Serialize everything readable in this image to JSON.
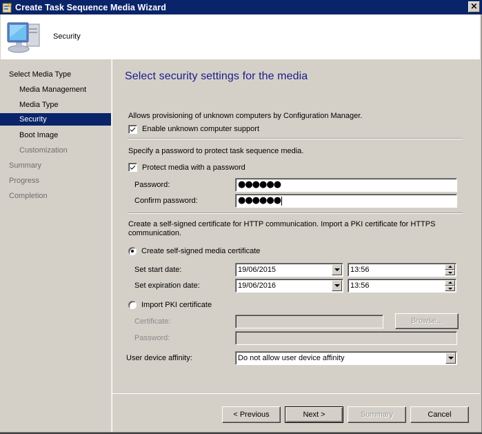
{
  "window": {
    "title": "Create Task Sequence Media Wizard",
    "close_label": "×",
    "app_icon": "wizard-icon"
  },
  "header": {
    "title": "Security",
    "icon": "computer-icon"
  },
  "nav": {
    "items": [
      {
        "label": "Select Media Type",
        "level": 1,
        "state": "normal"
      },
      {
        "label": "Media Management",
        "level": 2,
        "state": "normal"
      },
      {
        "label": "Media Type",
        "level": 2,
        "state": "normal"
      },
      {
        "label": "Security",
        "level": 2,
        "state": "active"
      },
      {
        "label": "Boot Image",
        "level": 2,
        "state": "normal"
      },
      {
        "label": "Customization",
        "level": 2,
        "state": "dim"
      },
      {
        "label": "Summary",
        "level": 1,
        "state": "dim"
      },
      {
        "label": "Progress",
        "level": 1,
        "state": "dim"
      },
      {
        "label": "Completion",
        "level": 1,
        "state": "dim"
      }
    ]
  },
  "content": {
    "page_title": "Select security settings for the media",
    "unknown": {
      "description": "Allows provisioning of unknown computers by Configuration Manager.",
      "checkbox_label": "Enable unknown computer support",
      "checked": true
    },
    "password_section": {
      "description": "Specify a password to protect task sequence media.",
      "checkbox_label": "Protect media with a password",
      "checked": true,
      "password_label": "Password:",
      "password_value": "●●●●●●",
      "confirm_label": "Confirm password:",
      "confirm_value": "●●●●●●"
    },
    "certificate": {
      "description_line1": "Create a self-signed certificate for HTTP communication. Import a PKI certificate for HTTPS",
      "description_line2": "communication.",
      "self_signed_label": "Create self-signed media certificate",
      "self_signed_selected": true,
      "start_date_label": "Set start date:",
      "start_date": "19/06/2015",
      "start_time": "13:56",
      "expiration_date_label": "Set expiration date:",
      "expiration_date": "19/06/2016",
      "expiration_time": "13:56",
      "import_label": "Import PKI certificate",
      "import_selected": false,
      "cert_label": "Certificate:",
      "cert_value": "",
      "cert_password_label": "Password:",
      "cert_password_value": "",
      "browse_label": "Browse..."
    },
    "affinity": {
      "label": "User device affinity:",
      "selected": "Do not allow user device affinity"
    }
  },
  "footer": {
    "previous_label": "< Previous",
    "next_label": "Next >",
    "summary_label": "Summary",
    "cancel_label": "Cancel"
  }
}
